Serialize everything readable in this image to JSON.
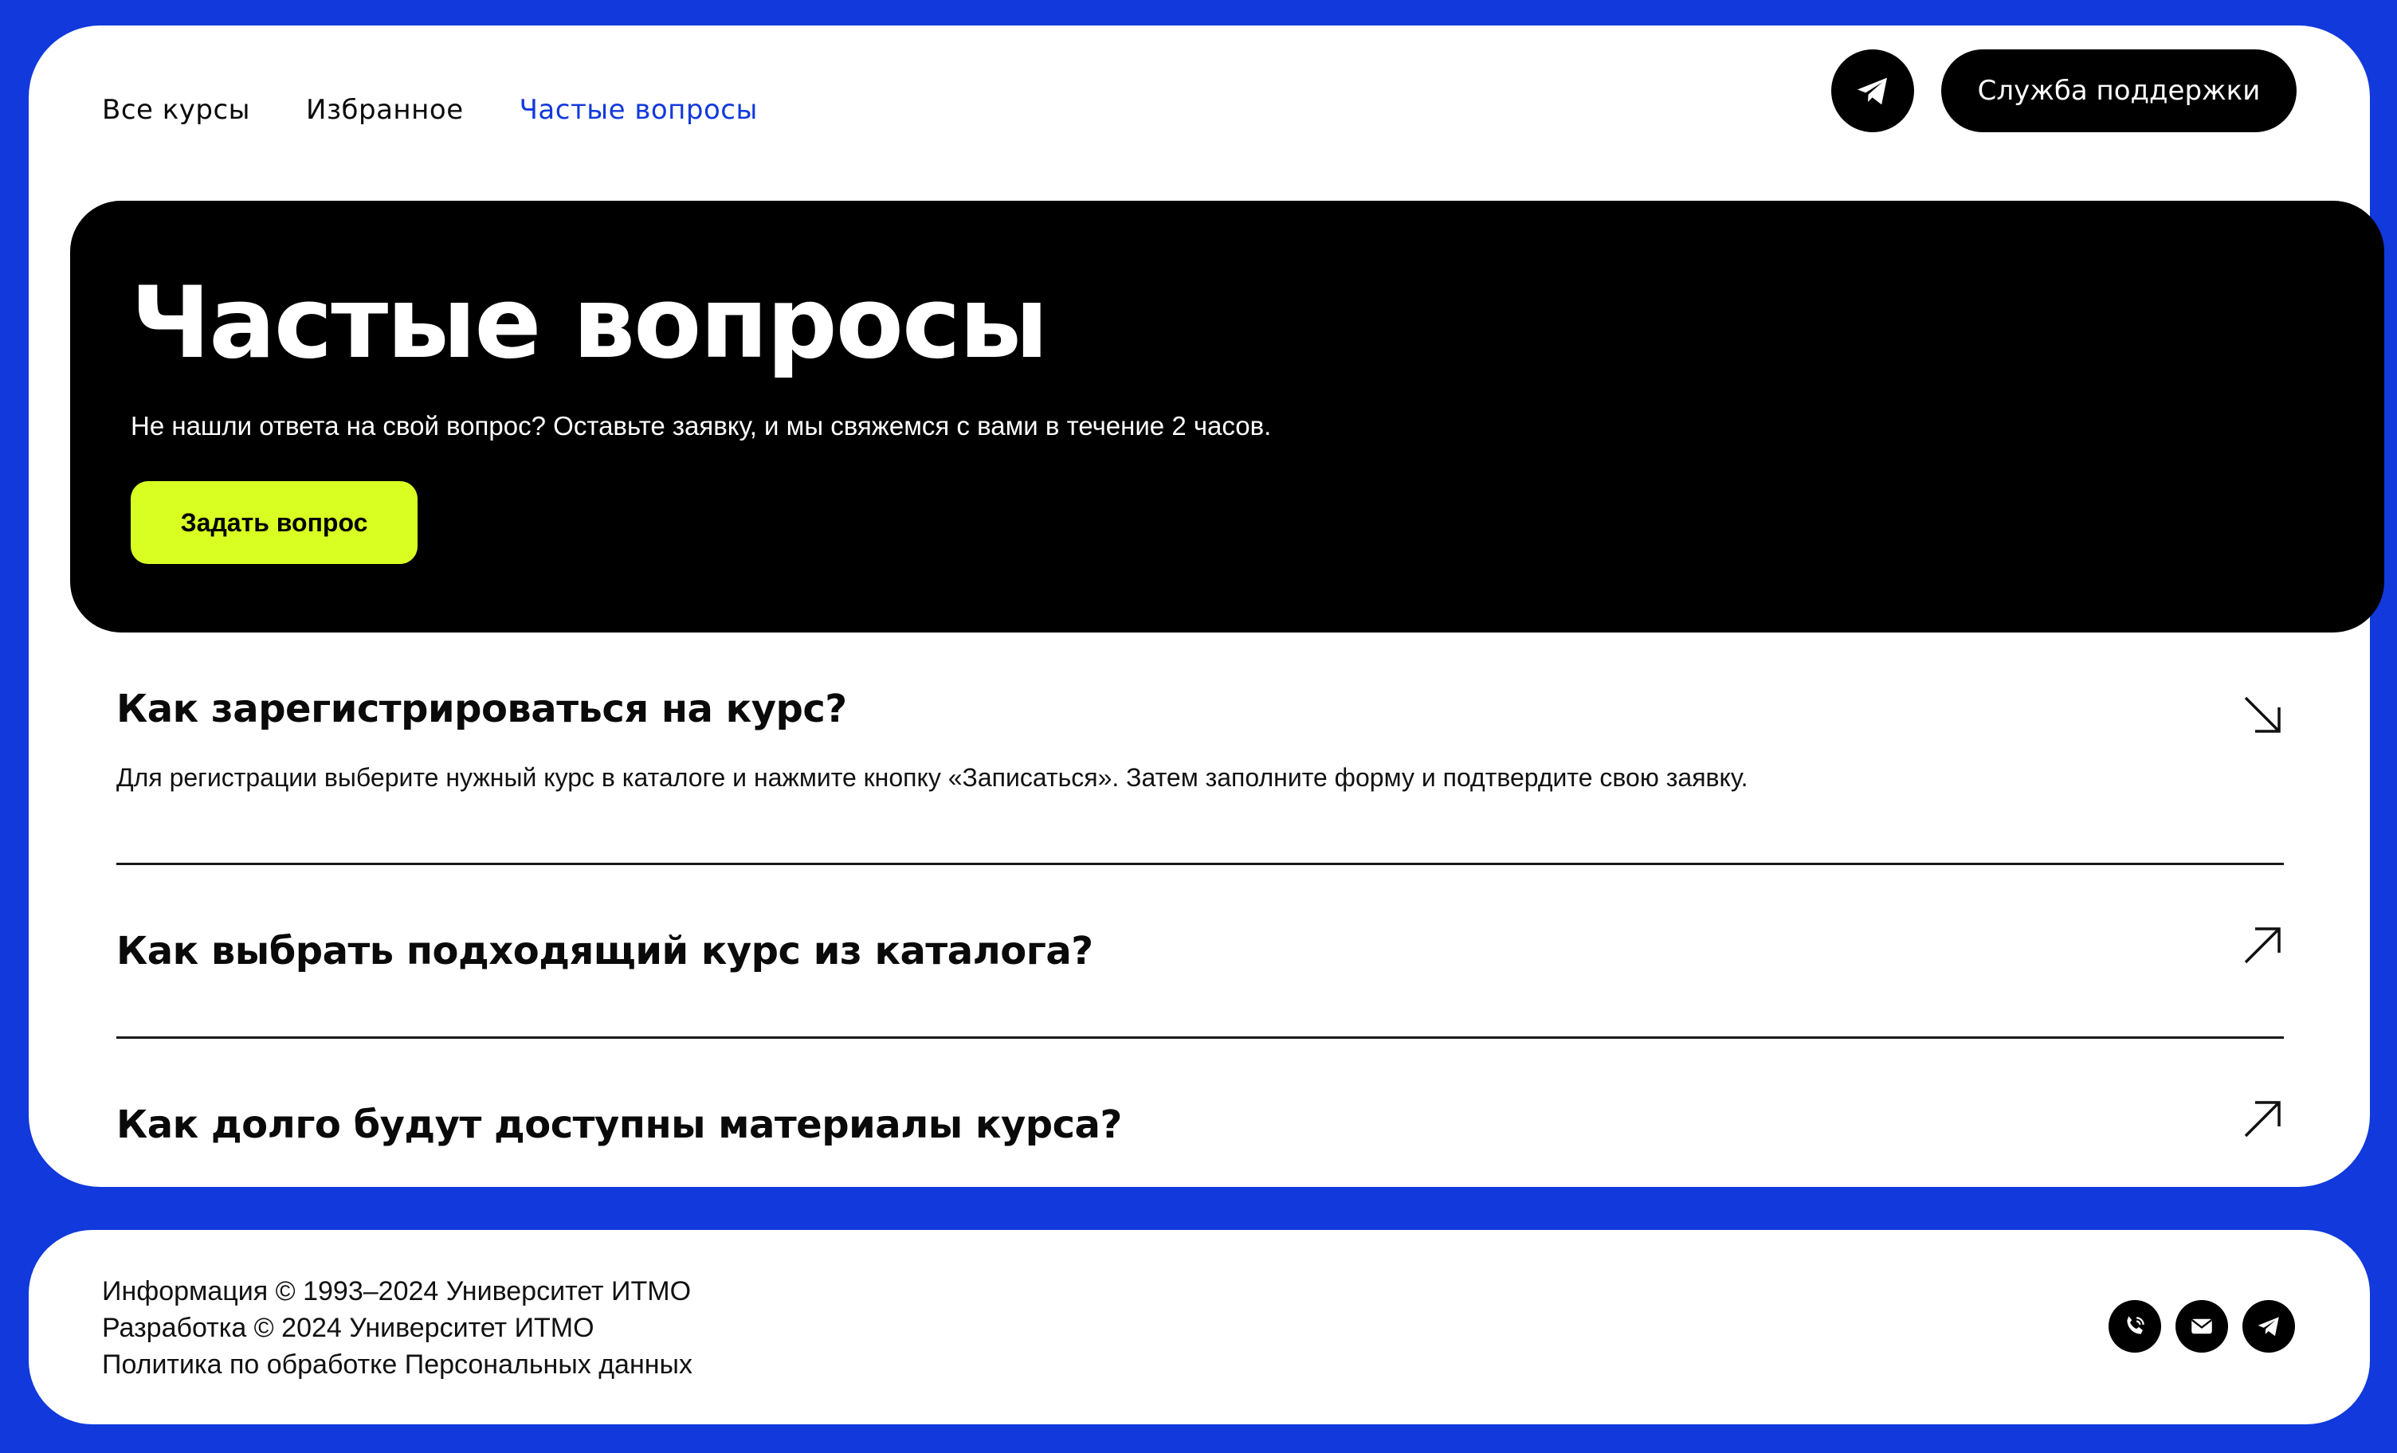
{
  "nav": {
    "items": [
      {
        "label": "Все курсы",
        "active": false
      },
      {
        "label": "Избранное",
        "active": false
      },
      {
        "label": "Частые вопросы",
        "active": true
      }
    ]
  },
  "header": {
    "support_label": "Служба поддержки",
    "telegram_icon": "telegram-icon"
  },
  "hero": {
    "title": "Частые вопросы",
    "subtitle": "Не нашли ответа на свой вопрос? Оставьте заявку, и мы свяжемся с вами в течение 2 часов.",
    "button_label": "Задать вопрос"
  },
  "faq": [
    {
      "question": "Как зарегистрироваться на курс?",
      "answer": "Для регистрации выберите нужный курс в каталоге и нажмите кнопку «Записаться». Затем заполните форму и подтвердите свою заявку.",
      "expanded": true
    },
    {
      "question": "Как выбрать подходящий курс из каталога?",
      "expanded": false
    },
    {
      "question": "Как долго будут доступны материалы курса?",
      "expanded": false
    }
  ],
  "footer": {
    "info": "Информация © 1993–2024 Университет ИТМО",
    "dev": "Разработка © 2024 Университет ИТМО",
    "policy": "Политика по обработке Персональных данных",
    "icons": [
      "phone-icon",
      "mail-icon",
      "telegram-icon"
    ]
  },
  "colors": {
    "accent": "#1139dc",
    "button_yellow": "#d9ff22",
    "dark": "#000000"
  }
}
